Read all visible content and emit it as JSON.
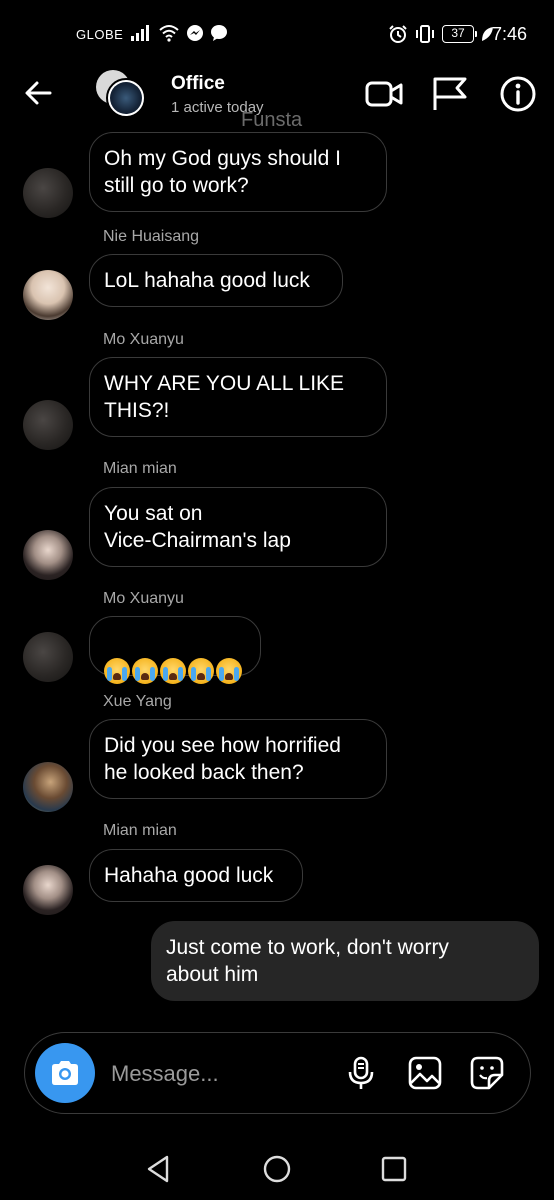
{
  "status_bar": {
    "carrier": "GLOBE",
    "battery": "37",
    "time": "7:46"
  },
  "header": {
    "title": "Office",
    "subtitle": "1 active today",
    "watermark": "Funsta"
  },
  "messages": [
    {
      "sender": "",
      "text": "Oh my God guys should I\nstill go to work?",
      "avatar": "mo"
    },
    {
      "sender": "Nie Huaisang",
      "text": "LoL hahaha good luck",
      "avatar": "nie"
    },
    {
      "sender": "Mo Xuanyu",
      "text": "WHY ARE YOU ALL LIKE\nTHIS?!",
      "avatar": "mo"
    },
    {
      "sender": "Mian mian",
      "text": "You sat on\nVice-Chairman's lap",
      "avatar": "mian"
    },
    {
      "sender": "Mo Xuanyu",
      "text": "",
      "emoji_count": 5,
      "avatar": "mo"
    },
    {
      "sender": "Xue Yang",
      "text": "Did you see how horrified\nhe looked back then?",
      "avatar": "xue"
    },
    {
      "sender": "Mian mian",
      "text": "Hahaha good luck",
      "avatar": "mian"
    },
    {
      "sender": "me",
      "text": "Just come to work, don't worry\nabout him"
    }
  ],
  "composer": {
    "placeholder": "Message..."
  },
  "icons": {
    "back": "arrow-left-icon",
    "video": "video-camera-icon",
    "flag": "flag-icon",
    "info": "info-icon",
    "camera": "camera-icon",
    "mic": "microphone-icon",
    "gallery": "image-icon",
    "sticker": "sticker-icon"
  },
  "colors": {
    "background": "#000000",
    "accent": "#3897f0",
    "outgoing_bubble": "#262626",
    "incoming_border": "#3a3a3a"
  }
}
